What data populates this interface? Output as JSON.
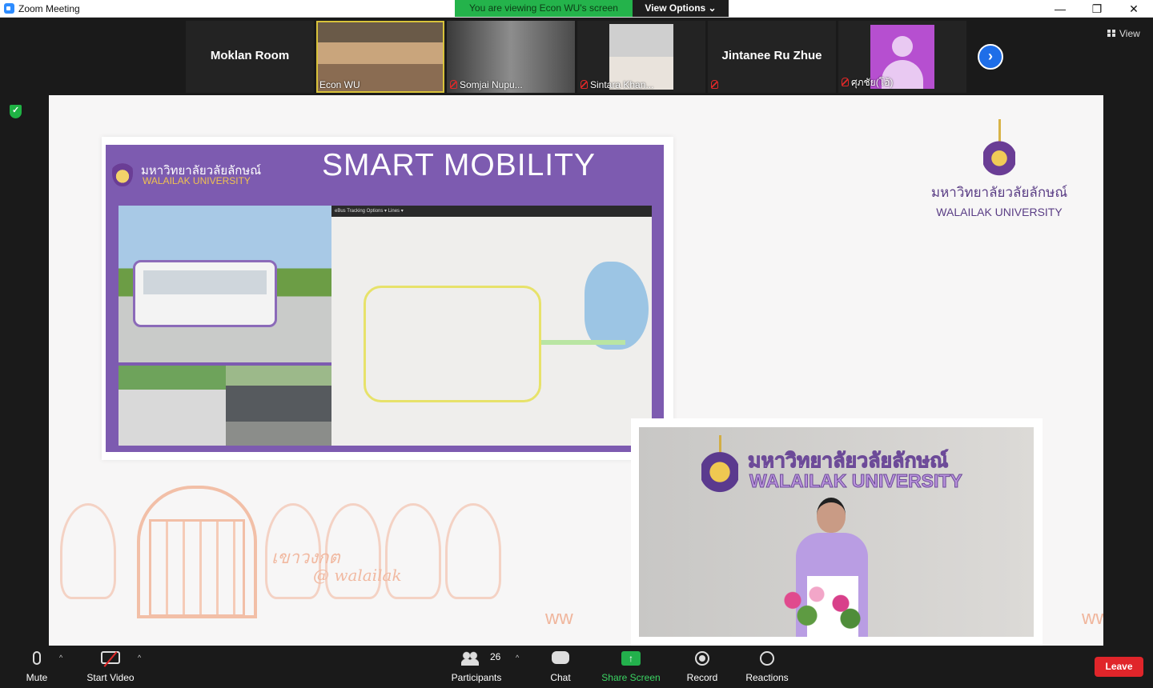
{
  "window": {
    "title": "Zoom Meeting",
    "minimize_glyph": "—",
    "restore_glyph": "❐",
    "close_glyph": "✕"
  },
  "banner": {
    "viewing_text": "You are viewing Econ WU's screen",
    "view_options_label": "View Options ⌄"
  },
  "participants_strip": [
    {
      "name": "Moklan Room",
      "video": false,
      "muted": false
    },
    {
      "name": "Econ WU",
      "video": true,
      "muted": false,
      "active_speaker": true
    },
    {
      "name": "Somjai Nupu...",
      "video": true,
      "muted": true
    },
    {
      "name": "Sintara Khan...",
      "video": true,
      "muted": true
    },
    {
      "name": "Jintanee Ru Zhue",
      "video": false,
      "muted": true
    },
    {
      "name": "ศุภชัย(โอ้)",
      "video": false,
      "muted": true,
      "avatar": true
    }
  ],
  "strip_controls": {
    "next_glyph": "›",
    "view_label": "View"
  },
  "shared_screen": {
    "slide": {
      "uni_name_th": "มหาวิทยาลัยวลัยลักษณ์",
      "uni_name_en": "WALAILAK UNIVERSITY",
      "title": "SMART MOBILITY",
      "map_toolbar": "eBus Tracking   Options ▾   Lines ▾"
    },
    "logo_right": {
      "name_th": "มหาวิทยาลัยวลัยลักษณ์",
      "name_en": "WALAILAK UNIVERSITY"
    },
    "deco_text_1": "เขาวงกต",
    "deco_text_2": "@ walailak",
    "video_overlay": {
      "name_th": "มหาวิทยาลัยวลัยลักษณ์",
      "name_en": "WALAILAK UNIVERSITY"
    }
  },
  "toolbar": {
    "mute": "Mute",
    "start_video": "Start Video",
    "participants": "Participants",
    "participant_count": "26",
    "chat": "Chat",
    "share_screen": "Share Screen",
    "share_glyph": "↑",
    "record": "Record",
    "reactions": "Reactions",
    "leave": "Leave",
    "caret": "^"
  },
  "colors": {
    "banner_green": "#24b34b",
    "leave_red": "#e0252a",
    "slide_purple": "#7d5bb0",
    "share_green": "#3bd463"
  }
}
